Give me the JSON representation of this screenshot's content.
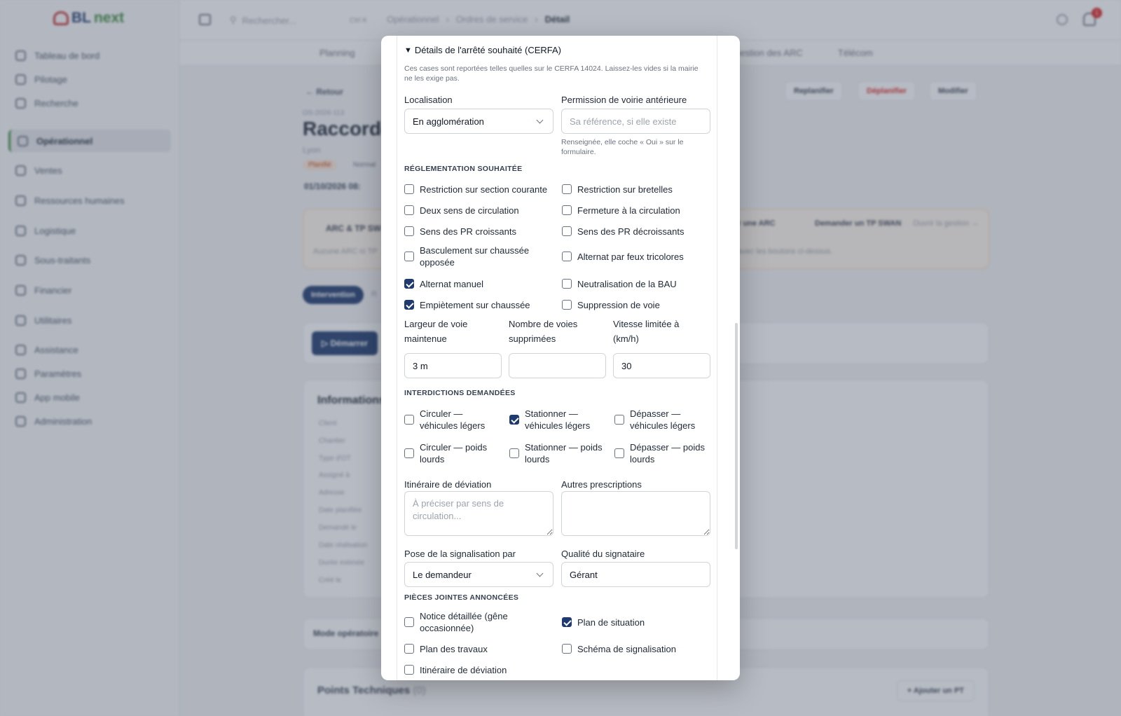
{
  "app": {
    "logo_prefix": "BL",
    "logo_suffix": "next",
    "sidebar": [
      {
        "label": "Tableau de bord",
        "active": false
      },
      {
        "label": "Pilotage",
        "active": false
      },
      {
        "label": "Recherche",
        "active": false
      },
      {
        "label": "Opérationnel",
        "active": true
      },
      {
        "label": "Ventes",
        "active": false
      },
      {
        "label": "Ressources humaines",
        "active": false
      },
      {
        "label": "Logistique",
        "active": false
      },
      {
        "label": "Sous-traitants",
        "active": false
      },
      {
        "label": "Financier",
        "active": false
      },
      {
        "label": "Utilitaires",
        "active": false
      },
      {
        "label": "Assistance",
        "active": false
      },
      {
        "label": "Paramètres",
        "active": false
      },
      {
        "label": "App mobile",
        "active": false
      },
      {
        "label": "Administration",
        "active": false
      }
    ],
    "search_placeholder": "Rechercher...",
    "search_shortcut": "Ctrl K",
    "breadcrumb": [
      "Opérationnel",
      "Ordres de service",
      "Détail"
    ],
    "notif_count": "1",
    "tabs": [
      "Planning",
      "Gestion des ARC",
      "Télécom"
    ],
    "back_label": "Retour",
    "ref": "OS-2026-113",
    "title": "Raccorde",
    "city": "Lyon",
    "status_pill": "Planifié",
    "type_pill": "Normal",
    "datetime": "01/10/2026 08:",
    "actions": [
      "Replanifier",
      "Déplanifier",
      "Modifier"
    ],
    "arc_title": "ARC & TP SW",
    "arc_empty": "Aucune ARC ni TP",
    "arc_hint": "avec les boutons ci-dessus.",
    "arc_buttons": [
      "er une ARC",
      "Demander un TP SWAN",
      "Ouvrir la gestion →"
    ],
    "view_tab": "Intervention",
    "view_tab2": "R",
    "start_label": "Démarrer",
    "info_title": "Informations",
    "info_rows": [
      "Client",
      "Chantier",
      "Type d'OT",
      "Assigné à",
      "Adresse",
      "Date planifiée",
      "Demandé le",
      "Date réalisation",
      "Durée estimée",
      "Créé le"
    ],
    "mode_title": "Mode opératoire",
    "pt_title": "Points Techniques",
    "pt_count": "(0)",
    "pt_add": "Ajouter un PT"
  },
  "modal": {
    "summary": "Détails de l'arrêté souhaité (CERFA)",
    "hint": "Ces cases sont reportées telles quelles sur le CERFA 14024. Laissez-les vides si la mairie ne les exige pas.",
    "localisation": {
      "label": "Localisation",
      "value": "En agglomération"
    },
    "permission": {
      "label": "Permission de voirie antérieure",
      "placeholder": "Sa référence, si elle existe",
      "help": "Renseignée, elle coche « Oui » sur le formulaire."
    },
    "reglementation": {
      "title": "RÉGLEMENTATION SOUHAITÉE",
      "options": [
        {
          "label": "Restriction sur section courante",
          "checked": false
        },
        {
          "label": "Restriction sur bretelles",
          "checked": false
        },
        {
          "label": "Deux sens de circulation",
          "checked": false
        },
        {
          "label": "Fermeture à la circulation",
          "checked": false
        },
        {
          "label": "Sens des PR croissants",
          "checked": false
        },
        {
          "label": "Sens des PR décroissants",
          "checked": false
        },
        {
          "label": "Basculement sur chaussée opposée",
          "checked": false
        },
        {
          "label": "Alternat par feux tricolores",
          "checked": false
        },
        {
          "label": "Alternat manuel",
          "checked": true
        },
        {
          "label": "Neutralisation de la BAU",
          "checked": false
        },
        {
          "label": "Empiètement sur chaussée",
          "checked": true
        },
        {
          "label": "Suppression de voie",
          "checked": false
        }
      ]
    },
    "largeur": {
      "label": "Largeur de voie maintenue",
      "value": "3 m"
    },
    "voies": {
      "label": "Nombre de voies supprimées",
      "value": ""
    },
    "vitesse": {
      "label": "Vitesse limitée à (km/h)",
      "value": "30"
    },
    "interdictions": {
      "title": "INTERDICTIONS DEMANDÉES",
      "options": [
        {
          "label": "Circuler — véhicules légers",
          "checked": false
        },
        {
          "label": "Stationner — véhicules légers",
          "checked": true
        },
        {
          "label": "Dépasser — véhicules légers",
          "checked": false
        },
        {
          "label": "Circuler — poids lourds",
          "checked": false
        },
        {
          "label": "Stationner — poids lourds",
          "checked": false
        },
        {
          "label": "Dépasser — poids lourds",
          "checked": false
        }
      ]
    },
    "itineraire": {
      "label": "Itinéraire de déviation",
      "placeholder": "À préciser par sens de circulation..."
    },
    "autres": {
      "label": "Autres prescriptions",
      "placeholder": ""
    },
    "pose": {
      "label": "Pose de la signalisation par",
      "value": "Le demandeur"
    },
    "qualite": {
      "label": "Qualité du signataire",
      "value": "Gérant"
    },
    "pieces": {
      "title": "PIÈCES JOINTES ANNONCÉES",
      "options": [
        {
          "label": "Notice détaillée (gêne occasionnée)",
          "checked": false
        },
        {
          "label": "Plan de situation",
          "checked": true
        },
        {
          "label": "Plan des travaux",
          "checked": false
        },
        {
          "label": "Schéma de signalisation",
          "checked": false
        },
        {
          "label": "Itinéraire de déviation",
          "checked": false
        }
      ]
    }
  }
}
